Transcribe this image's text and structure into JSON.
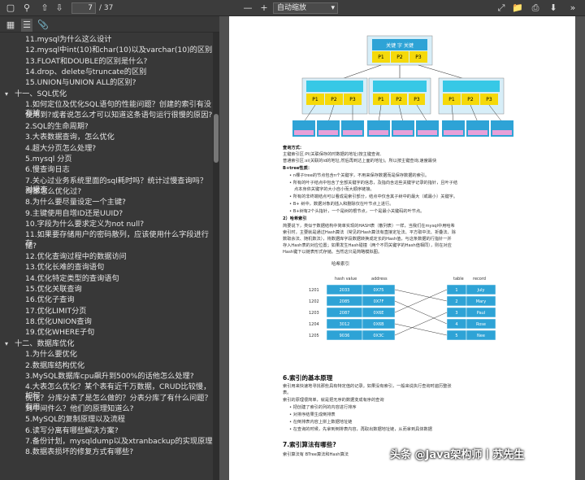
{
  "toolbar": {
    "page_current": "7",
    "page_total": "/ 37",
    "zoom": "自动缩放"
  },
  "outline": [
    {
      "text": "11.mysql为什么这么设计",
      "level": "sub"
    },
    {
      "text": "12.mysql中int(10)和char(10)以及varchar(10)的区别",
      "level": "sub"
    },
    {
      "text": "13.FLOAT和DOUBLE的区别是什么?",
      "level": "sub"
    },
    {
      "text": "14.drop、delete与truncate的区别",
      "level": "sub"
    },
    {
      "text": "15.UNION与UNION ALL的区别?",
      "level": "sub"
    },
    {
      "text": "十一、SQL优化",
      "level": "sec"
    },
    {
      "text": "1.如何定位及优化SQL语句的性能问题？创建的索引有没有被",
      "level": "sub"
    },
    {
      "text": "使用到?或者说怎么才可以知道这条语句运行很慢的原因?",
      "level": "sub"
    },
    {
      "text": "2.SQL的生命周期?",
      "level": "sub"
    },
    {
      "text": "3.大表数据查询，怎么优化",
      "level": "sub"
    },
    {
      "text": "4.超大分页怎么处理?",
      "level": "sub"
    },
    {
      "text": "5.mysql 分页",
      "level": "sub"
    },
    {
      "text": "6.慢查询日志",
      "level": "sub"
    },
    {
      "text": "7.关心过业务系统里面的sql耗时吗？统计过慢查询吗？对慢查",
      "level": "sub"
    },
    {
      "text": "询都怎么优化过?",
      "level": "sub"
    },
    {
      "text": "8.为什么要尽量设定一个主键?",
      "level": "sub"
    },
    {
      "text": "9.主键使用自增ID还是UUID?",
      "level": "sub"
    },
    {
      "text": "10.字段为什么要求定义为not null?",
      "level": "sub"
    },
    {
      "text": "11.如果要存储用户的密码散列，应该使用什么字段进行存",
      "level": "sub"
    },
    {
      "text": "储?",
      "level": "sub"
    },
    {
      "text": "12.优化查询过程中的数据访问",
      "level": "sub"
    },
    {
      "text": "13.优化长难的查询语句",
      "level": "sub"
    },
    {
      "text": "14.优化特定类型的查询语句",
      "level": "sub"
    },
    {
      "text": "15.优化关联查询",
      "level": "sub"
    },
    {
      "text": "16.优化子查询",
      "level": "sub"
    },
    {
      "text": "17.优化LIMIT分页",
      "level": "sub"
    },
    {
      "text": "18.优化UNION查询",
      "level": "sub"
    },
    {
      "text": "19.优化WHERE子句",
      "level": "sub"
    },
    {
      "text": "十二、数据库优化",
      "level": "sec"
    },
    {
      "text": "1.为什么要优化",
      "level": "sub"
    },
    {
      "text": "2.数据库结构优化",
      "level": "sub"
    },
    {
      "text": "3.MySQL数据库cpu飙升到500%的话他怎么处理?",
      "level": "sub"
    },
    {
      "text": "4.大表怎么优化？某个表有近千万数据，CRUD比较慢，如何",
      "level": "sub"
    },
    {
      "text": "优化？分库分表了是怎么做的？分表分库了有什么问题？有用",
      "level": "sub"
    },
    {
      "text": "到中间件么？他们的原理知道么?",
      "level": "sub"
    },
    {
      "text": "5.MySQL的复制原理以及流程",
      "level": "sub"
    },
    {
      "text": "6.读写分离有哪些解决方案?",
      "level": "sub"
    },
    {
      "text": "7.备份计划，mysqldump以及xtranbackup的实现原理",
      "level": "sub"
    },
    {
      "text": "8.数据表损坏的修复方式有哪些?",
      "level": "sub"
    }
  ],
  "document": {
    "p1_label": "查询方式：",
    "p1_lines": [
      "主键索引区:PI(关联保存的时数据的地址)按主键查询,",
      "普通索引区:si(关联的id的地址,然后再到达上面的地址)。所以按主键查询,速度最快"
    ],
    "btree_label": "B+tree性质：",
    "btree_items": [
      "n棵子tree的节点包含n个关键字，不用来保存数据而是保存数据的索引。",
      "所有的叶子结点中包含了全部关键字的信息，及指向含这些关键字记录的指针，且叶子结",
      "点本身依关键字的大小自小而大顺序链接。",
      "所有的非终端结点可以看成是索引部分，结点中仅含其子树中的最大（或最小）关键字。",
      "B+ 树中，数据对象的插入和删除仅在叶节点上进行。",
      "B+树有2个头指针，一个是树的根节点，一个是最小关键码的叶节点。"
    ],
    "hash_label": "2）哈希索引",
    "hash_lines": [
      "简要说下，类似于数据结构中简单实现的HASH表（散列表）一样，当我们在mysql中用哈希",
      "索引时，主要就是通过Hash算法（常见的Hash算法有直接定址法、平方取中法、折叠法、除",
      "数取余法、随机数法），将数据库字段数据转换成定长的Hash值，与这条数据的行指针一并",
      "存入Hash表的对应位置；如果发生Hash碰撞（两个不同关键字的Hash值相同），则在对应",
      "Hash键下以链表形式存储。当然这只是简略模拟图。"
    ],
    "hash_diagram": {
      "title": "哈希索引",
      "col_hash": "hash value",
      "col_addr": "address",
      "col_table": "table",
      "col_record": "record",
      "rows": [
        {
          "hash": "2033",
          "addr": "0X75",
          "table": "1",
          "record": "July"
        },
        {
          "hash": "2085",
          "addr": "0X7F",
          "table": "2",
          "record": "Mary"
        },
        {
          "hash": "2087",
          "addr": "0X6E",
          "table": "3",
          "record": "Paul"
        },
        {
          "hash": "3012",
          "addr": "0X6B",
          "table": "4",
          "record": "Rose"
        },
        {
          "hash": "9036",
          "addr": "0X3C",
          "table": "5",
          "record": "Nee"
        }
      ],
      "keys": [
        "1201",
        "1202",
        "1203",
        "1204",
        "1205"
      ]
    },
    "sec6_title": "6.索引的基本原理",
    "sec6_lines": [
      "索引用来快速地寻找那些具有特定值的记录。如果没有索引，一般来说执行查询时遍历整张",
      "表。",
      "索引的原理很简单，就是把无序的数据变成有序的查询"
    ],
    "sec6_items": [
      "把创建了索引的列的内容进行排序",
      "对排序结果生成倒排表",
      "在倒排表内容上拼上数据地址链",
      "在查询的时候，先拿到倒排表内容，再取出数据地址链，从而拿到具体数据"
    ],
    "sec7_title": "7.索引算法有哪些?",
    "sec7_line": "索引算法有 BTree算法和Hash算法",
    "watermark": "头条 @Java架构师丨苏先生"
  },
  "colors": {
    "blue": "#2ea3d6",
    "yellow": "#f5d90a",
    "pink": "#e7a0d8",
    "cyan": "#37c8e6"
  }
}
